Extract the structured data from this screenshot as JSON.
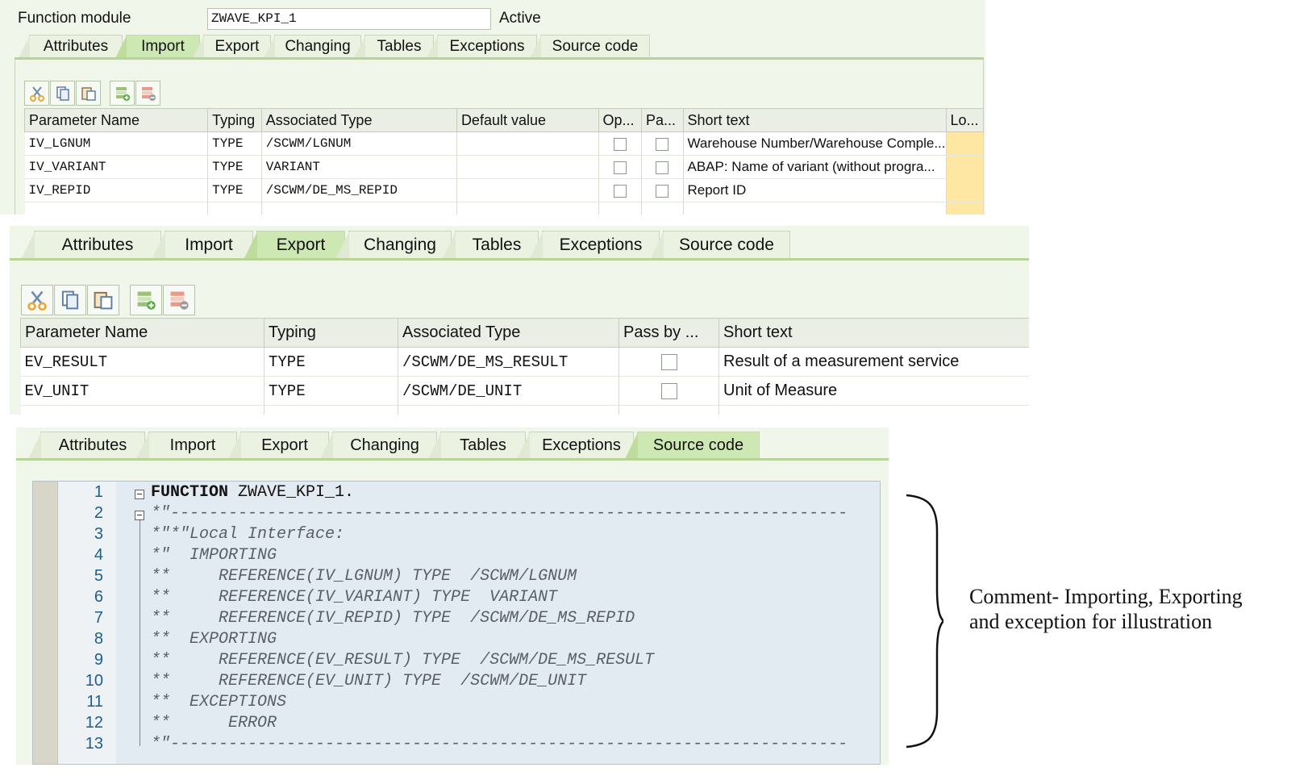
{
  "panel1": {
    "function_module_label": "Function module",
    "function_module_value": "ZWAVE_KPI_1",
    "status": "Active",
    "tabs": [
      {
        "label": "Attributes",
        "active": false
      },
      {
        "label": "Import",
        "active": true
      },
      {
        "label": "Export",
        "active": false
      },
      {
        "label": "Changing",
        "active": false
      },
      {
        "label": "Tables",
        "active": false
      },
      {
        "label": "Exceptions",
        "active": false
      },
      {
        "label": "Source code",
        "active": false
      }
    ],
    "toolbar": [
      "cut-icon",
      "copy-icon",
      "paste-icon",
      "insert-row-icon",
      "delete-row-icon"
    ],
    "columns": [
      "Parameter Name",
      "Typing",
      "Associated Type",
      "Default value",
      "Op...",
      "Pa...",
      "Short text",
      "Lo..."
    ],
    "rows": [
      {
        "name": "IV_LGNUM",
        "typing": "TYPE",
        "assoc_type": "/SCWM/LGNUM",
        "default": "",
        "optional": false,
        "pass": false,
        "short_text": "Warehouse Number/Warehouse Comple..."
      },
      {
        "name": "IV_VARIANT",
        "typing": "TYPE",
        "assoc_type": "VARIANT",
        "default": "",
        "optional": false,
        "pass": false,
        "short_text": "ABAP: Name of variant (without progra..."
      },
      {
        "name": "IV_REPID",
        "typing": "TYPE",
        "assoc_type": "/SCWM/DE_MS_REPID",
        "default": "",
        "optional": false,
        "pass": false,
        "short_text": "Report ID"
      }
    ]
  },
  "panel2": {
    "tabs": [
      {
        "label": "Attributes",
        "active": false
      },
      {
        "label": "Import",
        "active": false
      },
      {
        "label": "Export",
        "active": true
      },
      {
        "label": "Changing",
        "active": false
      },
      {
        "label": "Tables",
        "active": false
      },
      {
        "label": "Exceptions",
        "active": false
      },
      {
        "label": "Source code",
        "active": false
      }
    ],
    "toolbar": [
      "cut-icon",
      "copy-icon",
      "paste-icon",
      "insert-row-icon",
      "delete-row-icon"
    ],
    "columns": [
      "Parameter Name",
      "Typing",
      "Associated Type",
      "Pass by ...",
      "Short text"
    ],
    "rows": [
      {
        "name": "EV_RESULT",
        "typing": "TYPE",
        "assoc_type": "/SCWM/DE_MS_RESULT",
        "pass": false,
        "short_text": "Result of a measurement service"
      },
      {
        "name": "EV_UNIT",
        "typing": "TYPE",
        "assoc_type": "/SCWM/DE_UNIT",
        "pass": false,
        "short_text": "Unit of Measure"
      }
    ]
  },
  "panel3": {
    "tabs": [
      {
        "label": "Attributes",
        "active": false
      },
      {
        "label": "Import",
        "active": false
      },
      {
        "label": "Export",
        "active": false
      },
      {
        "label": "Changing",
        "active": false
      },
      {
        "label": "Tables",
        "active": false
      },
      {
        "label": "Exceptions",
        "active": false
      },
      {
        "label": "Source code",
        "active": true
      }
    ],
    "code_lines": [
      {
        "n": "1",
        "text": "FUNCTION ZWAVE_KPI_1.",
        "keyword": "FUNCTION"
      },
      {
        "n": "2",
        "text": "*\"----------------------------------------------------------------------"
      },
      {
        "n": "3",
        "text": "*\"*\"Local Interface:"
      },
      {
        "n": "4",
        "text": "*\"  IMPORTING"
      },
      {
        "n": "5",
        "text": "**     REFERENCE(IV_LGNUM) TYPE  /SCWM/LGNUM"
      },
      {
        "n": "6",
        "text": "**     REFERENCE(IV_VARIANT) TYPE  VARIANT"
      },
      {
        "n": "7",
        "text": "**     REFERENCE(IV_REPID) TYPE  /SCWM/DE_MS_REPID"
      },
      {
        "n": "8",
        "text": "**  EXPORTING"
      },
      {
        "n": "9",
        "text": "**     REFERENCE(EV_RESULT) TYPE  /SCWM/DE_MS_RESULT"
      },
      {
        "n": "10",
        "text": "**     REFERENCE(EV_UNIT) TYPE  /SCWM/DE_UNIT"
      },
      {
        "n": "11",
        "text": "**  EXCEPTIONS"
      },
      {
        "n": "12",
        "text": "**      ERROR"
      },
      {
        "n": "13",
        "text": "*\"----------------------------------------------------------------------"
      }
    ]
  },
  "annotation": {
    "line1": "Comment- Importing, Exporting",
    "line2": "and exception for illustration"
  },
  "colors": {
    "panel_bg": "#f1f6ea",
    "active_tab": "#cde8b2",
    "tab_line": "#b6d497",
    "lookup_cell": "#fde7a3",
    "editor_bg": "#e3ebf2",
    "line_number": "#1c5f8e"
  }
}
